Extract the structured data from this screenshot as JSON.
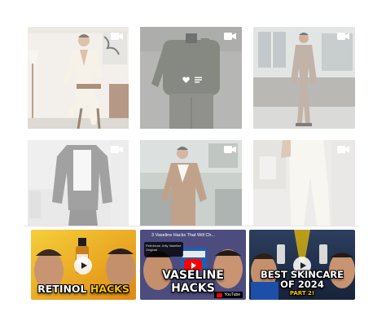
{
  "grid": {
    "posts": [
      {
        "name": "post-beige-suit-chair",
        "icon": "video-camera-icon"
      },
      {
        "name": "post-olive-sweater-selfie",
        "icon": "video-camera-icon",
        "hover_icons": [
          "heart-icon",
          "comment-icon"
        ]
      },
      {
        "name": "post-taupe-suit-street",
        "icon": "video-camera-icon"
      },
      {
        "name": "post-black-bomber",
        "icon": "video-camera-icon"
      },
      {
        "name": "post-suede-jacket",
        "icon": "video-camera-icon"
      },
      {
        "name": "post-cream-trousers",
        "icon": "video-camera-icon"
      }
    ]
  },
  "videos": [
    {
      "caption_pre": "RETINOL ",
      "caption_hl": "HACKS",
      "accent": "#f2b705"
    },
    {
      "title": "3 Vaseline Hacks That Will Ch...",
      "chip_text": "Petroleum Jelly Vaseline Original",
      "caption": "VASELINE HACKS",
      "logo_text": "YouTube",
      "accent": "#ff0000"
    },
    {
      "caption_line1": "BEST SKINCARE",
      "caption_line2": "OF 2024",
      "subcaption": "PART 2!",
      "accent": "#f7c500"
    }
  ],
  "colors": {
    "background": "#ffffff",
    "veil": "rgba(255,255,255,0.38)"
  }
}
